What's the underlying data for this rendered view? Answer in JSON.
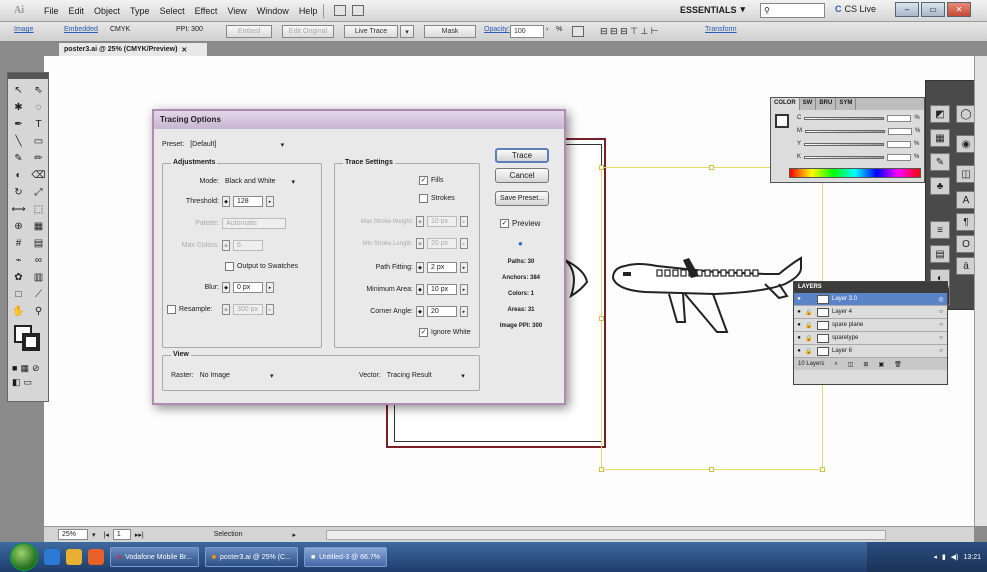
{
  "menubar": {
    "logo": "Ai",
    "items": [
      "File",
      "Edit",
      "Object",
      "Type",
      "Select",
      "Effect",
      "View",
      "Window",
      "Help"
    ],
    "workspace": "ESSENTIALS",
    "search_placeholder": "",
    "cslive": "CS Live"
  },
  "controlbar": {
    "label": "Image",
    "embedded": "Embedded",
    "colormode": "CMYK",
    "ppi": "PPI: 300",
    "embed": "Embed",
    "edit_original": "Edit Original",
    "live_trace": "Live Trace",
    "mask": "Mask",
    "opacity_label": "Opacity:",
    "opacity_value": "100",
    "opacity_unit": "%",
    "transform": "Transform"
  },
  "document": {
    "tab": "poster3.ai @ 25% (CMYK/Preview)"
  },
  "dialog": {
    "title": "Tracing Options",
    "preset_label": "Preset:",
    "preset_value": "[Default]",
    "adjustments": {
      "title": "Adjustments",
      "mode_label": "Mode:",
      "mode_value": "Black and White",
      "threshold_label": "Threshold:",
      "threshold_value": "128",
      "palette_label": "Palette:",
      "palette_value": "Automatic",
      "maxcolors_label": "Max Colors:",
      "maxcolors_value": "6",
      "output_swatches": "Output to Swatches",
      "blur_label": "Blur:",
      "blur_value": "0 px",
      "resample_label": "Resample:",
      "resample_value": "300 px"
    },
    "trace": {
      "title": "Trace Settings",
      "fills": "Fills",
      "strokes": "Strokes",
      "maxstroke_label": "Max Stroke Weight:",
      "maxstroke_value": "10 px",
      "minstroke_label": "Min Stroke Length:",
      "minstroke_value": "20 px",
      "pathfit_label": "Path Fitting:",
      "pathfit_value": "2 px",
      "minarea_label": "Minimum Area:",
      "minarea_value": "10 px",
      "corner_label": "Corner Angle:",
      "corner_value": "20",
      "ignore_white": "Ignore White"
    },
    "view": {
      "title": "View",
      "raster_label": "Raster:",
      "raster_value": "No Image",
      "vector_label": "Vector:",
      "vector_value": "Tracing Result"
    },
    "buttons": {
      "trace": "Trace",
      "cancel": "Cancel",
      "save_preset": "Save Preset...",
      "preview": "Preview"
    },
    "stats": {
      "paths": "Paths: 30",
      "anchors": "Anchors: 384",
      "colors": "Colors: 1",
      "areas": "Areas: 31",
      "image_ppi": "Image PPI: 300"
    }
  },
  "colorpanel": {
    "tabs": [
      "COLOR",
      "SW",
      "BRU",
      "SYM"
    ],
    "channels": [
      "C",
      "M",
      "Y",
      "K"
    ],
    "units": [
      "%",
      "%",
      "%",
      "%"
    ]
  },
  "layers": {
    "title": "LAYERS",
    "rows": [
      {
        "name": "Layer 3.0",
        "selected": true
      },
      {
        "name": "Layer 4",
        "selected": false
      },
      {
        "name": "spare plane",
        "selected": false
      },
      {
        "name": "sparetype",
        "selected": false
      },
      {
        "name": "Layer 6",
        "selected": false
      }
    ],
    "footer": "10 Layers"
  },
  "statusbar": {
    "zoom": "25%",
    "page": "1",
    "tool": "Selection"
  },
  "taskbar": {
    "tasks": [
      "Vodafone Mobile Br...",
      "poster3.ai @ 25% (C...",
      "Untitled-3 @ 66.7%"
    ],
    "time": "13:21"
  },
  "colors": {
    "dialog_border": "#b08ab0",
    "selection": "#5b83c8",
    "artboard_border": "#7a1f28",
    "yellow_bbox": "#e8d76b"
  }
}
